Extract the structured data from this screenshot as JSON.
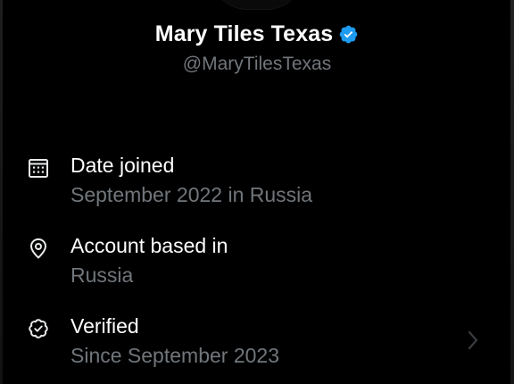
{
  "profile": {
    "display_name": "Mary Tiles Texas",
    "handle": "@MaryTilesTexas",
    "badge_icon": "verified-badge-icon",
    "badge_color": "#1d9bf0"
  },
  "rows": [
    {
      "icon": "calendar-icon",
      "title": "Date joined",
      "subtitle": "September 2022 in Russia"
    },
    {
      "icon": "location-pin-icon",
      "title": "Account based in",
      "subtitle": "Russia"
    },
    {
      "icon": "verified-check-icon",
      "title": "Verified",
      "subtitle": "Since September 2023",
      "has_chevron": true
    }
  ],
  "colors": {
    "background": "#000000",
    "primary_text": "#ffffff",
    "secondary_text": "#71767b",
    "accent": "#1d9bf0"
  }
}
